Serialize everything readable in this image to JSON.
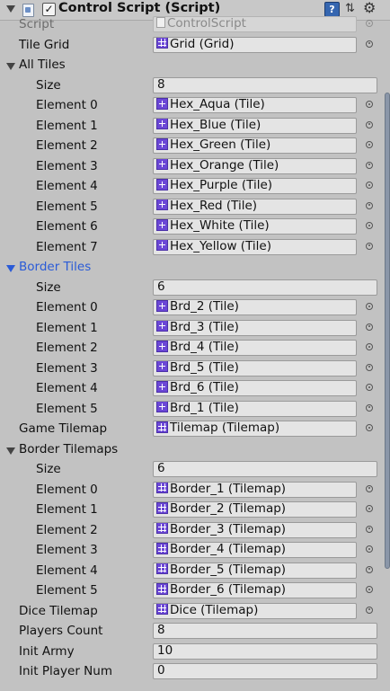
{
  "header": {
    "title": "Control Script (Script)",
    "checkbox_mark": "✓",
    "help_glyph": "?",
    "preset_glyph": "⇅",
    "gear_glyph": "⚙"
  },
  "rows": [
    {
      "name": "script",
      "label": "Script",
      "indent": 0,
      "value": "ControlScript",
      "icon": "script-icon",
      "disabled": true
    },
    {
      "name": "tile-grid",
      "label": "Tile Grid",
      "indent": 0,
      "value": "Grid (Grid)",
      "icon": "grid-icon",
      "picker": true
    },
    {
      "name": "all-tiles",
      "label": "All Tiles",
      "indent": 0,
      "foldout": true
    },
    {
      "name": "all-tiles-size",
      "label": "Size",
      "indent": 1,
      "value": "8",
      "wide": true
    },
    {
      "name": "all-tiles-element-0",
      "label": "Element 0",
      "indent": 1,
      "value": "Hex_Aqua (Tile)",
      "icon": "tile-icon",
      "picker": true
    },
    {
      "name": "all-tiles-element-1",
      "label": "Element 1",
      "indent": 1,
      "value": "Hex_Blue (Tile)",
      "icon": "tile-icon",
      "picker": true
    },
    {
      "name": "all-tiles-element-2",
      "label": "Element 2",
      "indent": 1,
      "value": "Hex_Green (Tile)",
      "icon": "tile-icon",
      "picker": true
    },
    {
      "name": "all-tiles-element-3",
      "label": "Element 3",
      "indent": 1,
      "value": "Hex_Orange (Tile)",
      "icon": "tile-icon",
      "picker": true
    },
    {
      "name": "all-tiles-element-4",
      "label": "Element 4",
      "indent": 1,
      "value": "Hex_Purple (Tile)",
      "icon": "tile-icon",
      "picker": true
    },
    {
      "name": "all-tiles-element-5",
      "label": "Element 5",
      "indent": 1,
      "value": "Hex_Red (Tile)",
      "icon": "tile-icon",
      "picker": true
    },
    {
      "name": "all-tiles-element-6",
      "label": "Element 6",
      "indent": 1,
      "value": "Hex_White (Tile)",
      "icon": "tile-icon",
      "picker": true
    },
    {
      "name": "all-tiles-element-7",
      "label": "Element 7",
      "indent": 1,
      "value": "Hex_Yellow (Tile)",
      "icon": "tile-icon",
      "picker": true
    },
    {
      "name": "border-tiles",
      "label": "Border Tiles",
      "indent": 0,
      "foldout": true,
      "focused": true
    },
    {
      "name": "border-tiles-size",
      "label": "Size",
      "indent": 1,
      "value": "6",
      "wide": true
    },
    {
      "name": "border-tiles-element-0",
      "label": "Element 0",
      "indent": 1,
      "value": "Brd_2 (Tile)",
      "icon": "tile-icon",
      "picker": true
    },
    {
      "name": "border-tiles-element-1",
      "label": "Element 1",
      "indent": 1,
      "value": "Brd_3 (Tile)",
      "icon": "tile-icon",
      "picker": true
    },
    {
      "name": "border-tiles-element-2",
      "label": "Element 2",
      "indent": 1,
      "value": "Brd_4 (Tile)",
      "icon": "tile-icon",
      "picker": true
    },
    {
      "name": "border-tiles-element-3",
      "label": "Element 3",
      "indent": 1,
      "value": "Brd_5 (Tile)",
      "icon": "tile-icon",
      "picker": true
    },
    {
      "name": "border-tiles-element-4",
      "label": "Element 4",
      "indent": 1,
      "value": "Brd_6 (Tile)",
      "icon": "tile-icon",
      "picker": true
    },
    {
      "name": "border-tiles-element-5",
      "label": "Element 5",
      "indent": 1,
      "value": "Brd_1 (Tile)",
      "icon": "tile-icon",
      "picker": true
    },
    {
      "name": "game-tilemap",
      "label": "Game Tilemap",
      "indent": 0,
      "value": "Tilemap (Tilemap)",
      "icon": "grid-icon",
      "picker": true
    },
    {
      "name": "border-tilemaps",
      "label": "Border Tilemaps",
      "indent": 0,
      "foldout": true
    },
    {
      "name": "border-tilemaps-size",
      "label": "Size",
      "indent": 1,
      "value": "6",
      "wide": true
    },
    {
      "name": "border-tilemaps-element-0",
      "label": "Element 0",
      "indent": 1,
      "value": "Border_1 (Tilemap)",
      "icon": "grid-icon",
      "picker": true
    },
    {
      "name": "border-tilemaps-element-1",
      "label": "Element 1",
      "indent": 1,
      "value": "Border_2 (Tilemap)",
      "icon": "grid-icon",
      "picker": true
    },
    {
      "name": "border-tilemaps-element-2",
      "label": "Element 2",
      "indent": 1,
      "value": "Border_3 (Tilemap)",
      "icon": "grid-icon",
      "picker": true
    },
    {
      "name": "border-tilemaps-element-3",
      "label": "Element 3",
      "indent": 1,
      "value": "Border_4 (Tilemap)",
      "icon": "grid-icon",
      "picker": true
    },
    {
      "name": "border-tilemaps-element-4",
      "label": "Element 4",
      "indent": 1,
      "value": "Border_5 (Tilemap)",
      "icon": "grid-icon",
      "picker": true
    },
    {
      "name": "border-tilemaps-element-5",
      "label": "Element 5",
      "indent": 1,
      "value": "Border_6 (Tilemap)",
      "icon": "grid-icon",
      "picker": true
    },
    {
      "name": "dice-tilemap",
      "label": "Dice Tilemap",
      "indent": 0,
      "value": "Dice (Tilemap)",
      "icon": "grid-icon",
      "picker": true
    },
    {
      "name": "players-count",
      "label": "Players Count",
      "indent": 0,
      "value": "8",
      "wide": true
    },
    {
      "name": "init-army",
      "label": "Init Army",
      "indent": 0,
      "value": "10",
      "wide": true
    },
    {
      "name": "init-player-num",
      "label": "Init Player Num",
      "indent": 0,
      "value": "0",
      "wide": true
    }
  ],
  "colors": {
    "panel_bg": "#c2c2c2",
    "focus_blue": "#2a5bd7",
    "tile_icon": "#6b47d6"
  }
}
